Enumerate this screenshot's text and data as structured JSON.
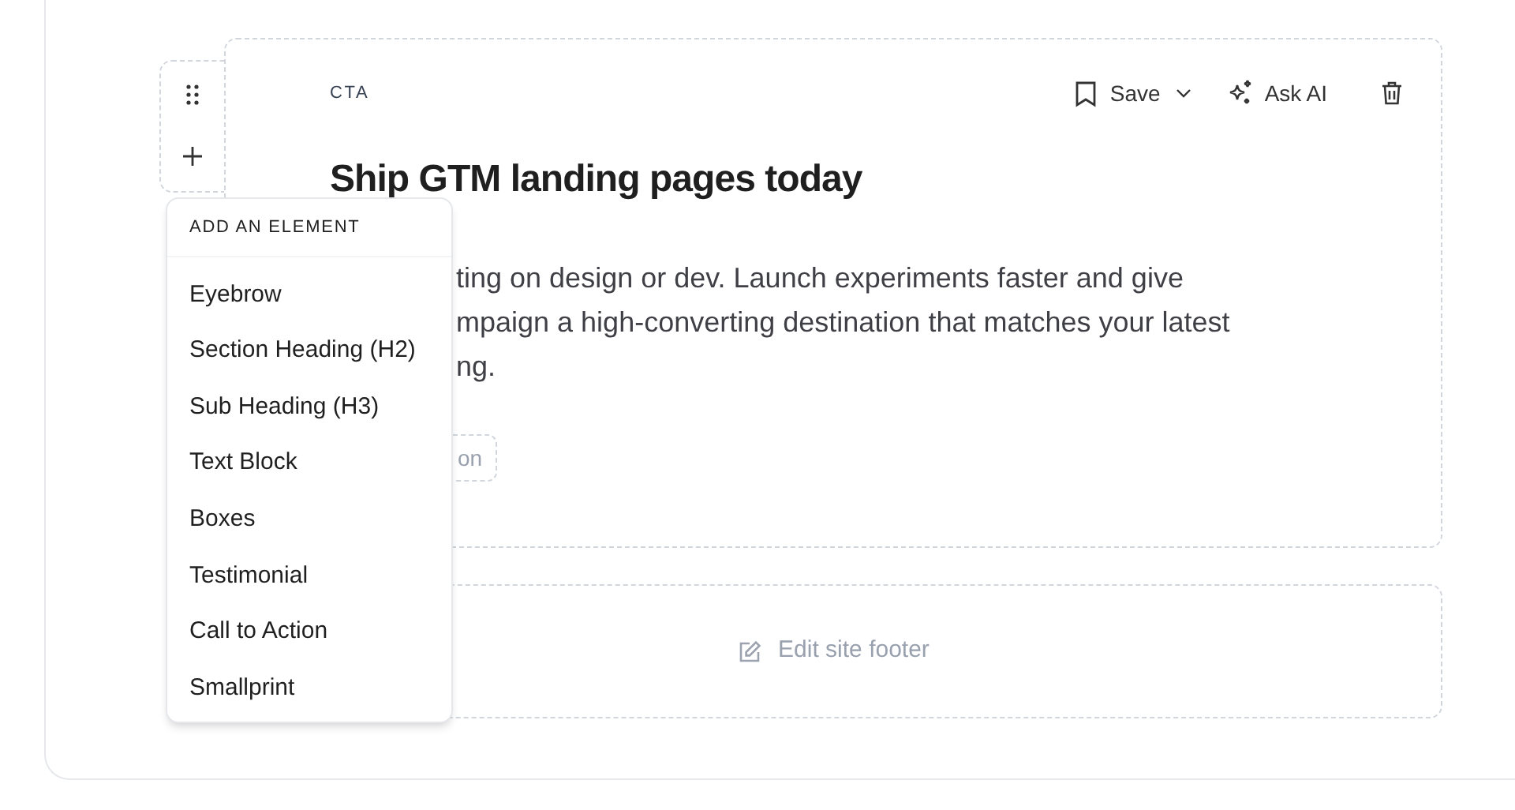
{
  "section": {
    "label": "CTA",
    "actions": [
      {
        "kind": "save",
        "label": "Save"
      },
      {
        "kind": "ai",
        "label": "Ask AI"
      },
      {
        "kind": "delete"
      }
    ],
    "heading": "Ship GTM landing pages today",
    "paragraph_lines": [
      "ting on design or dev. Launch experiments faster and give",
      "mpaign a high-converting destination that matches your latest",
      "ng."
    ],
    "button": {
      "label": "on"
    }
  },
  "footer": {
    "label": "Edit site footer"
  },
  "menu": {
    "title": "ADD AN ELEMENT",
    "items": [
      "Eyebrow",
      "Section Heading (H2)",
      "Sub Heading (H3)",
      "Text Block",
      "Boxes",
      "Testimonial",
      "Call to Action",
      "Smallprint"
    ]
  }
}
